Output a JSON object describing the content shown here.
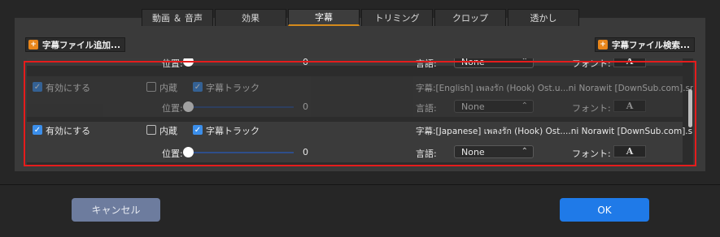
{
  "tabs": [
    {
      "label": "動画 ＆ 音声",
      "active": false
    },
    {
      "label": "効果",
      "active": false
    },
    {
      "label": "字幕",
      "active": true
    },
    {
      "label": "トリミング",
      "active": false
    },
    {
      "label": "クロップ",
      "active": false
    },
    {
      "label": "透かし",
      "active": false
    }
  ],
  "toolbar": {
    "add_subtitle_label": "字幕ファイル追加...",
    "search_subtitle_label": "字幕ファイル検索..."
  },
  "partial_row": {
    "position_label": "位置:",
    "position_value": "0",
    "language_label": "言語:",
    "language_value": "None",
    "font_label": "フォント:"
  },
  "subtitles": [
    {
      "enable_label": "有効にする",
      "embedded_label": "内蔵",
      "track_label": "字幕トラック",
      "file_text": "字幕:[English] เพลงรัก (Hook) Ost.u...ni Norawit [DownSub.com].srt",
      "position_label": "位置:",
      "position_value": "0",
      "language_label": "言語:",
      "language_value": "None",
      "font_label": "フォント:",
      "dimmed": true
    },
    {
      "enable_label": "有効にする",
      "embedded_label": "内蔵",
      "track_label": "字幕トラック",
      "file_text": "字幕:[Japanese] เพลงรัก (Hook) Ost....ni Norawit [DownSub.com].srt",
      "position_label": "位置:",
      "position_value": "0",
      "language_label": "言語:",
      "language_value": "None",
      "font_label": "フォント:",
      "dimmed": false
    }
  ],
  "buttons": {
    "cancel_label": "キャンセル",
    "ok_label": "OK"
  },
  "colors": {
    "accent": "#1f7ae8",
    "active_tab_underline": "#d48a1c",
    "highlight_box": "#e51c1c",
    "checkbox": "#3b8eea"
  }
}
